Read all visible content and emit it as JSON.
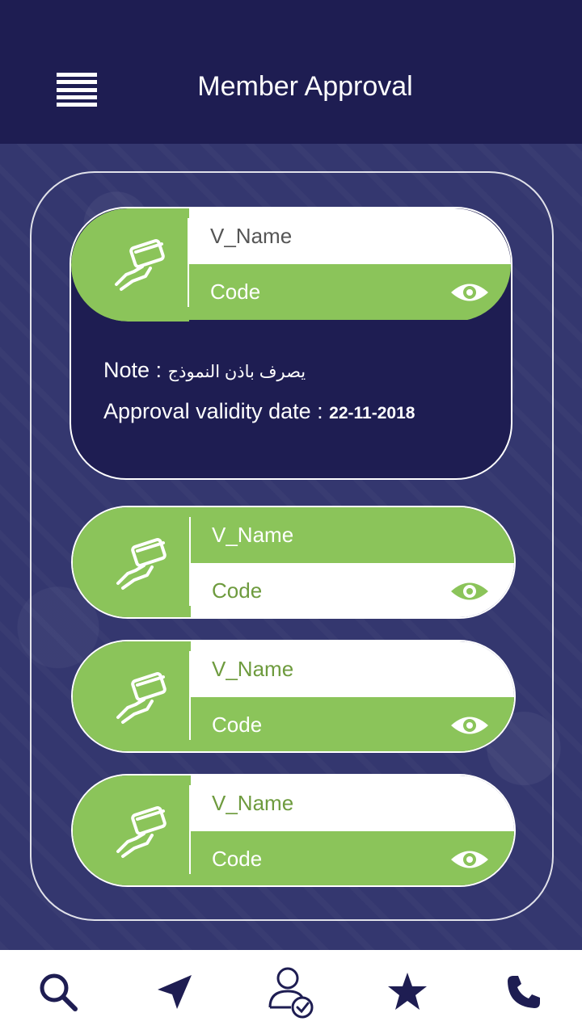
{
  "header": {
    "title": "Member Approval"
  },
  "expanded_card": {
    "name": "V_Name",
    "code": "Code",
    "note_label": "Note :",
    "note_value": "يصرف باذن النموذج",
    "validity_label": "Approval validity date :",
    "validity_value": "22-11-2018"
  },
  "cards": [
    {
      "name": "V_Name",
      "code": "Code"
    },
    {
      "name": "V_Name",
      "code": "Code"
    },
    {
      "name": "V_Name",
      "code": "Code"
    }
  ],
  "bottom_nav": [
    "search-icon",
    "location-arrow-icon",
    "user-check-icon",
    "star-icon",
    "phone-icon"
  ],
  "colors": {
    "header": "#1e1d52",
    "accent_green": "#8bc45a",
    "nav_icon": "#1e1d52"
  }
}
